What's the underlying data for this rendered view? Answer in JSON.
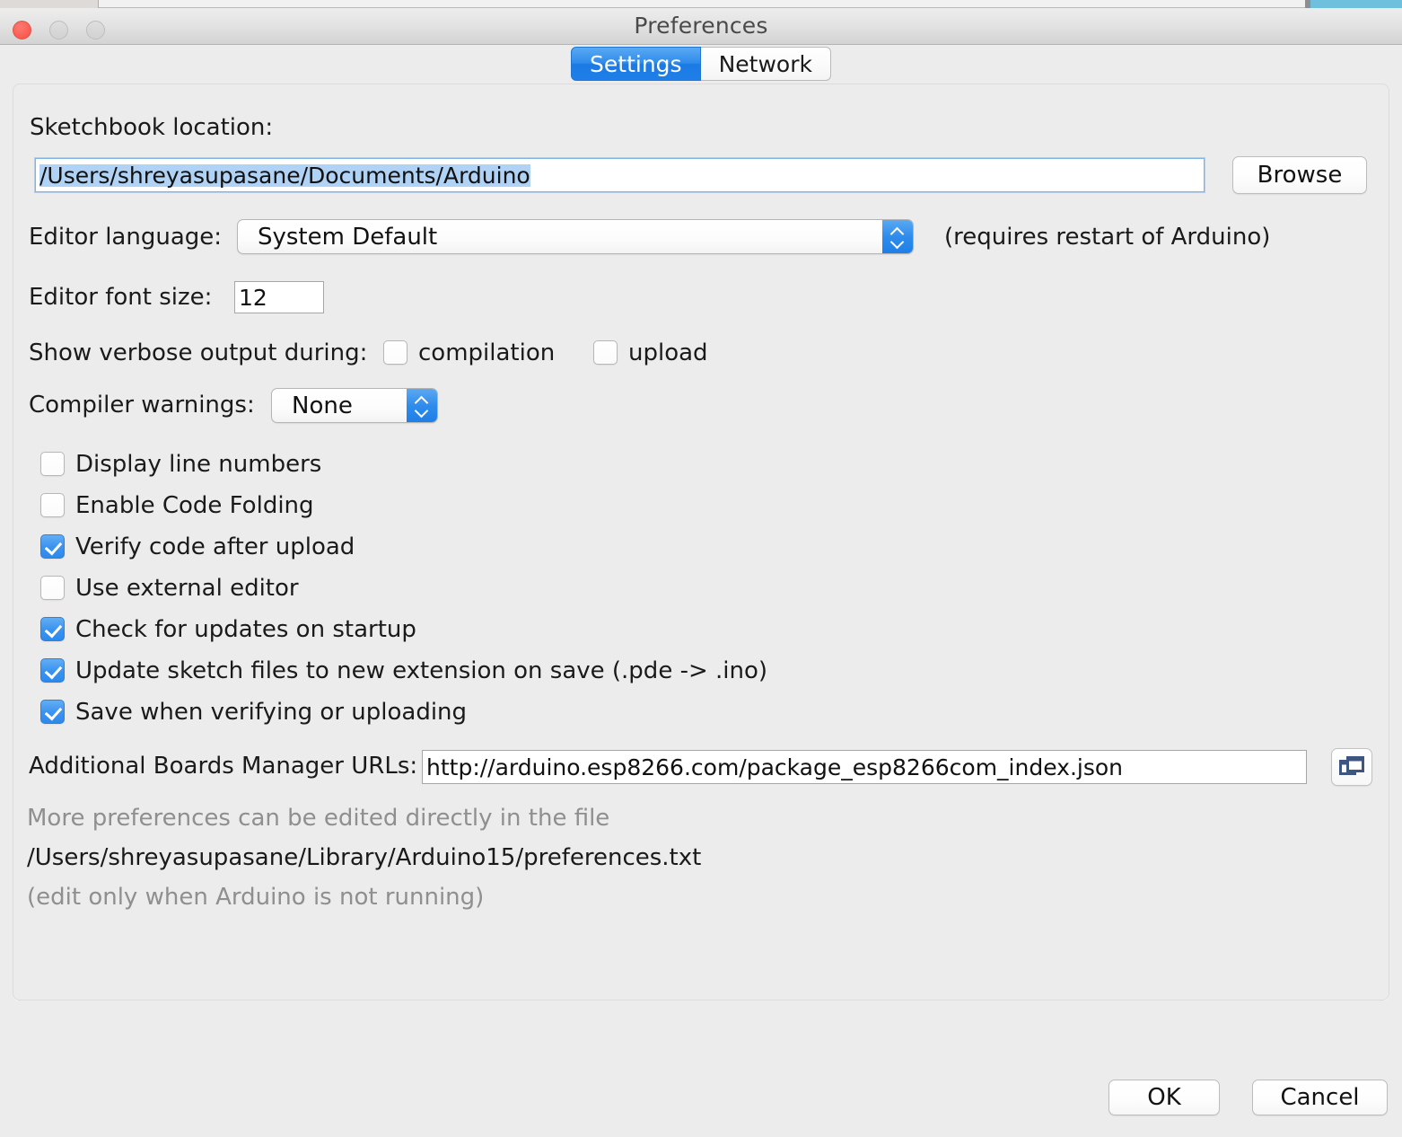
{
  "window": {
    "title": "Preferences",
    "traffic_lights": [
      "close",
      "minimize",
      "zoom"
    ]
  },
  "tabs": [
    {
      "label": "Settings",
      "active": true
    },
    {
      "label": "Network",
      "active": false
    }
  ],
  "settings": {
    "sketchbook_label": "Sketchbook location:",
    "sketchbook_value": "/Users/shreyasupasane/Documents/Arduino",
    "browse_label": "Browse",
    "editor_language_label": "Editor language:",
    "editor_language_value": "System Default",
    "editor_language_note": "(requires restart of Arduino)",
    "editor_font_label": "Editor font size:",
    "editor_font_value": "12",
    "verbose_label": "Show verbose output during:",
    "verbose_compilation_label": "compilation",
    "verbose_compilation_checked": false,
    "verbose_upload_label": "upload",
    "verbose_upload_checked": false,
    "compiler_warnings_label": "Compiler warnings:",
    "compiler_warnings_value": "None",
    "checkboxes": [
      {
        "label": "Display line numbers",
        "checked": false
      },
      {
        "label": "Enable Code Folding",
        "checked": false
      },
      {
        "label": "Verify code after upload",
        "checked": true
      },
      {
        "label": "Use external editor",
        "checked": false
      },
      {
        "label": "Check for updates on startup",
        "checked": true
      },
      {
        "label": "Update sketch files to new extension on save (.pde -> .ino)",
        "checked": true
      },
      {
        "label": "Save when verifying or uploading",
        "checked": true
      }
    ],
    "boards_urls_label": "Additional Boards Manager URLs:",
    "boards_urls_value": "http://arduino.esp8266.com/package_esp8266com_index.json",
    "boards_urls_icon": "open-windows-icon",
    "footer_line1": "More preferences can be edited directly in the file",
    "footer_line2": "/Users/shreyasupasane/Library/Arduino15/preferences.txt",
    "footer_line3": "(edit only when Arduino is not running)"
  },
  "footer": {
    "ok_label": "OK",
    "cancel_label": "Cancel"
  },
  "colors": {
    "accent_blue": "#2d89ec",
    "selection_blue": "#b0d2f5",
    "window_bg": "#ececec",
    "icon_navy": "#3d5580",
    "muted_text": "#8f8f8f"
  }
}
